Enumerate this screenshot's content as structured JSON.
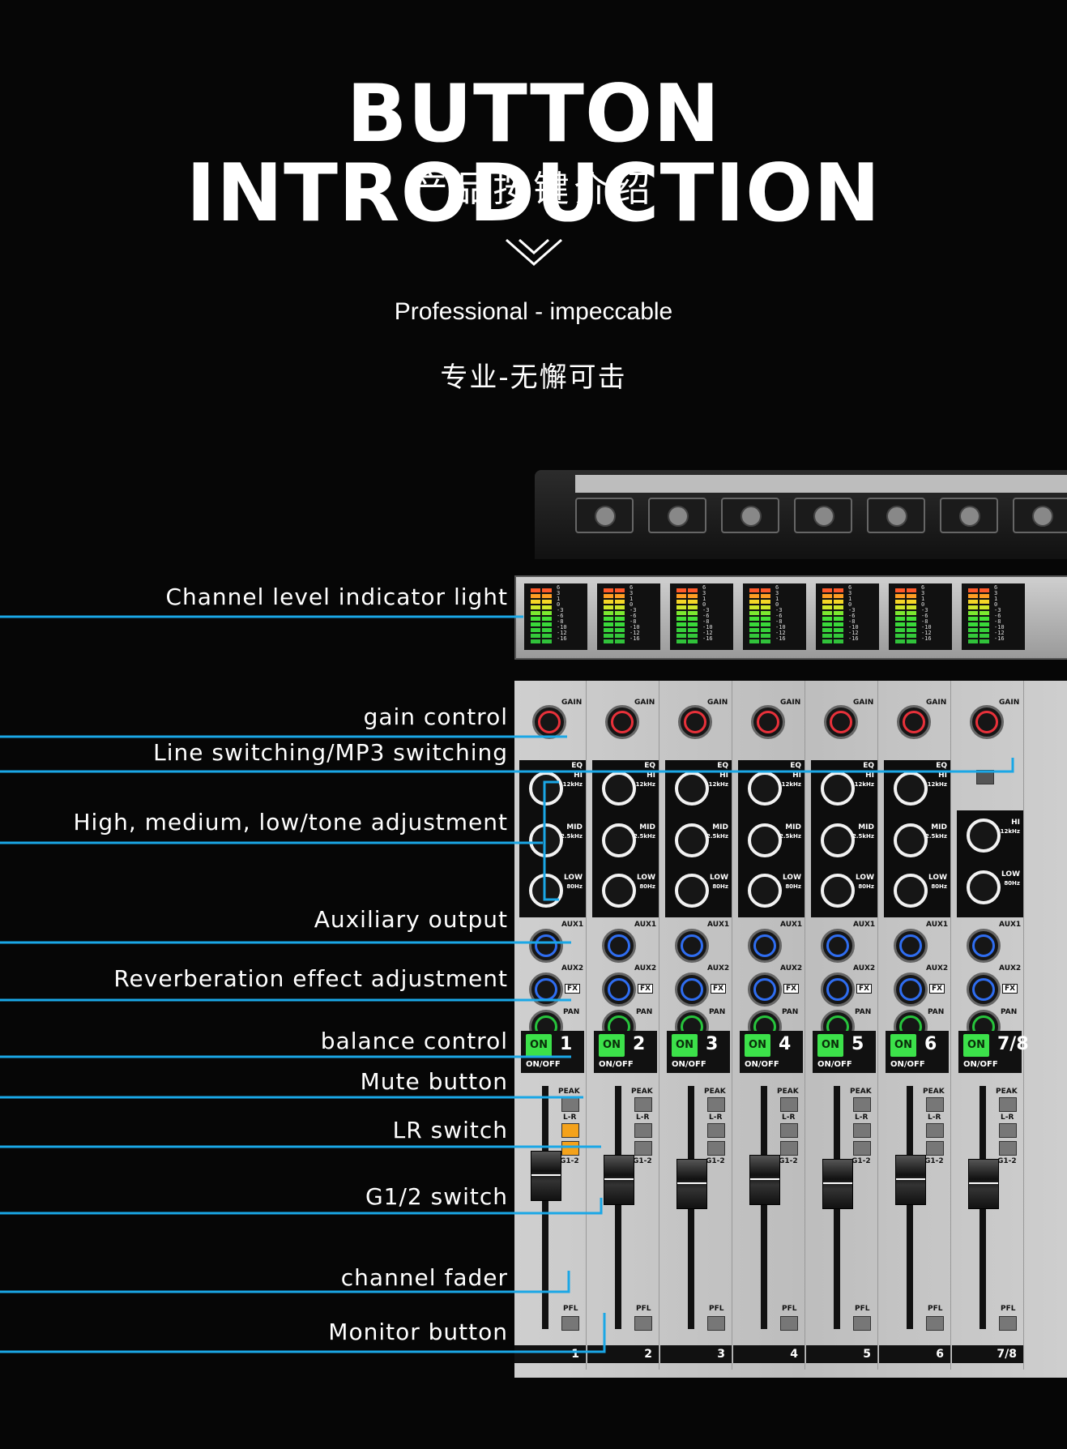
{
  "header": {
    "title": "BUTTON INTRODUCTION",
    "subtitle_cn": "产品按键介绍",
    "tagline": "Professional - impeccable",
    "tagline_cn": "专业-无懈可击"
  },
  "callouts": [
    {
      "id": "level",
      "label": "Channel level indicator light"
    },
    {
      "id": "gain",
      "label": "gain control"
    },
    {
      "id": "line",
      "label": "Line switching/MP3 switching"
    },
    {
      "id": "eq",
      "label": "High, medium, low/tone adjustment"
    },
    {
      "id": "aux",
      "label": "Auxiliary output"
    },
    {
      "id": "fx",
      "label": "Reverberation effect adjustment"
    },
    {
      "id": "pan",
      "label": "balance control"
    },
    {
      "id": "mute",
      "label": "Mute button"
    },
    {
      "id": "lr",
      "label": "LR switch"
    },
    {
      "id": "g12",
      "label": "G1/2 switch"
    },
    {
      "id": "fader",
      "label": "channel fader"
    },
    {
      "id": "monitor",
      "label": "Monitor button"
    }
  ],
  "mixer": {
    "channels": [
      "1",
      "2",
      "3",
      "4",
      "5",
      "6",
      "7/8"
    ],
    "knob_labels": {
      "gain": "GAIN",
      "eq": "EQ",
      "hi": "HI",
      "hi_freq": "12kHz",
      "mid": "MID",
      "mid_freq": "2.5kHz",
      "low": "LOW",
      "low_freq": "80Hz",
      "aux1": "AUX1",
      "aux2": "AUX2",
      "fx": "FX",
      "pan": "PAN"
    },
    "on_label": "ON",
    "onoff_label": "ON/OFF",
    "peak_label": "PEAK",
    "lr_label": "L-R",
    "g12_label": "G1-2",
    "pfl_label": "PFL",
    "meter_scale": [
      "6",
      "3",
      "1",
      "0",
      "-3",
      "-6",
      "-8",
      "-10",
      "-12",
      "-16"
    ],
    "colors": {
      "gain_ring": "#e8313a",
      "aux_ring": "#2f6df0",
      "pan_ring": "#27c43c",
      "on_lamp": "#3ce14a",
      "lr_btn": "#f4a21b",
      "accent_line": "#1aa7e6"
    }
  }
}
